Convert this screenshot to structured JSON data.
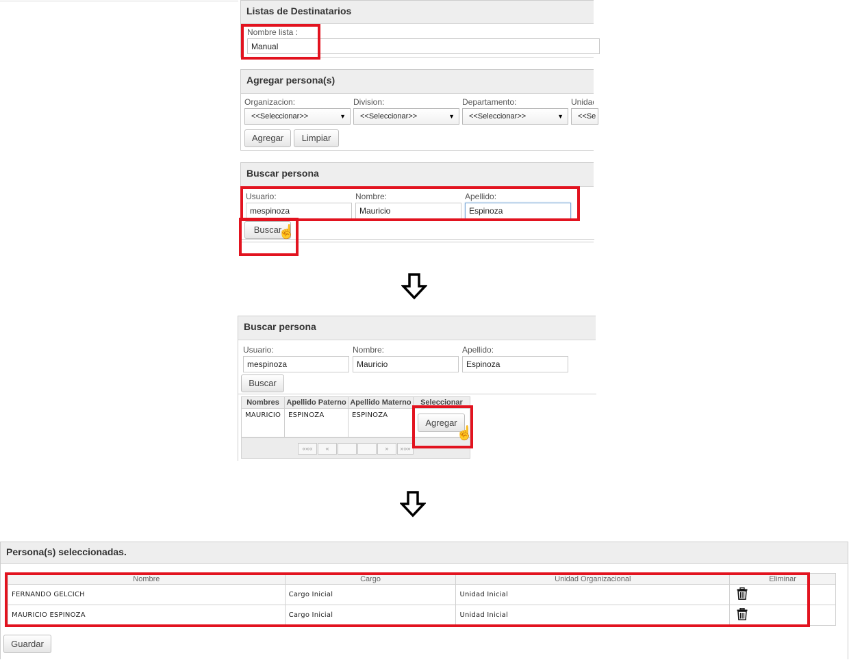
{
  "step1": {
    "list_panel": {
      "title": "Listas de Destinatarios",
      "name_label": "Nombre lista :",
      "name_value": "Manual"
    },
    "add_panel": {
      "title": "Agregar persona(s)",
      "fields": [
        {
          "label": "Organizacion:",
          "value": "<<Seleccionar>>"
        },
        {
          "label": "Division:",
          "value": "<<Seleccionar>>"
        },
        {
          "label": "Departamento:",
          "value": "<<Seleccionar>>"
        },
        {
          "label": "Unidad",
          "value": "<<Se"
        }
      ],
      "add_button": "Agregar",
      "clear_button": "Limpiar"
    },
    "search_panel": {
      "title": "Buscar persona",
      "user_label": "Usuario:",
      "user_value": "mespinoza",
      "name_label": "Nombre:",
      "name_value": "Mauricio",
      "lastname_label": "Apellido:",
      "lastname_value": "Espinoza",
      "search_button": "Buscar"
    }
  },
  "step2": {
    "search_panel": {
      "title": "Buscar persona",
      "user_label": "Usuario:",
      "user_value": "mespinoza",
      "name_label": "Nombre:",
      "name_value": "Mauricio",
      "lastname_label": "Apellido:",
      "lastname_value": "Espinoza",
      "search_button": "Buscar"
    },
    "results": {
      "columns": [
        "Nombres",
        "Apellido Paterno",
        "Apellido Materno",
        "Seleccionar"
      ],
      "rows": [
        {
          "nombres": "MAURICIO",
          "paterno": "ESPINOZA",
          "materno": "ESPINOZA",
          "action": "Agregar"
        }
      ],
      "pager": [
        "«««",
        "«",
        "",
        "",
        "»",
        "»»»"
      ]
    }
  },
  "step3": {
    "panel_title": "Persona(s) seleccionadas.",
    "columns": [
      "Nombre",
      "Cargo",
      "Unidad Organizacional",
      "Eliminar"
    ],
    "rows": [
      {
        "nombre": "FERNANDO GELCICH",
        "cargo": "Cargo Inicial",
        "unidad": "Unidad Inicial"
      },
      {
        "nombre": "MAURICIO ESPINOZA",
        "cargo": "Cargo Inicial",
        "unidad": "Unidad Inicial"
      }
    ],
    "save_button": "Guardar"
  },
  "icons": {
    "trash": "trash-icon",
    "hand_cursor": "hand-pointer-icon",
    "arrow": "arrow-down-icon",
    "dropdown": "chevron-down-icon"
  },
  "colors": {
    "highlight": "#e2131f",
    "panel_header": "#eeeeee"
  }
}
